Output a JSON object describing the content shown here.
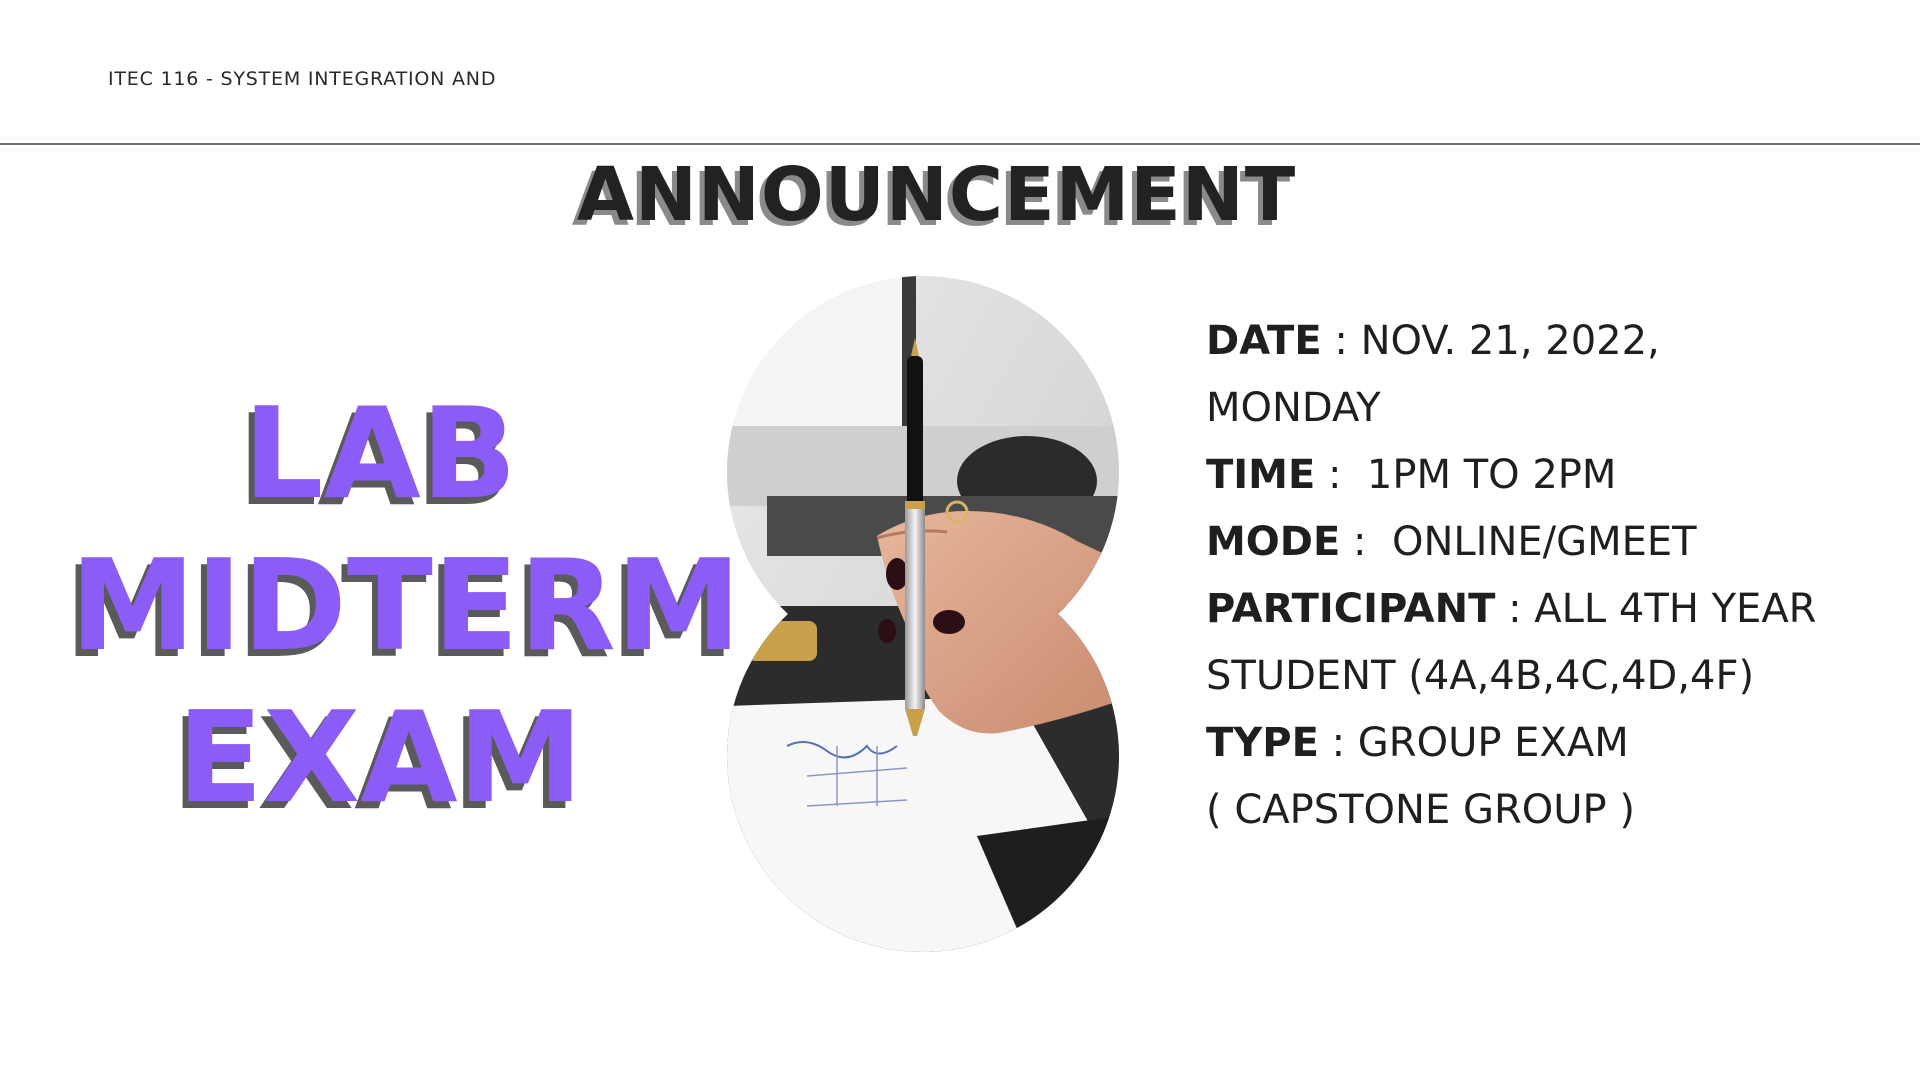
{
  "header": {
    "course": "ITEC 116 - SYSTEM INTEGRATION AND"
  },
  "headline": "ANNOUNCEMENT",
  "title": {
    "line1": "LAB",
    "line2": "MIDTERM",
    "line3": "EXAM"
  },
  "details": {
    "date_label": "DATE",
    "date_sep": " : ",
    "date_value": "NOV. 21, 2022,",
    "date_value2": "MONDAY",
    "time_label": "TIME",
    "time_sep": " :  ",
    "time_value": "1PM TO 2PM",
    "mode_label": "MODE",
    "mode_sep": " :  ",
    "mode_value": "ONLINE/GMEET",
    "participant_label": "PARTICIPANT",
    "participant_sep": " : ",
    "participant_value": "ALL 4TH YEAR",
    "participant_value2": "STUDENT (4A,4B,4C,4D,4F)",
    "type_label": "TYPE",
    "type_sep": " : ",
    "type_value": "GROUP EXAM",
    "type_value2": "( CAPSTONE GROUP )"
  },
  "colors": {
    "accent": "#8b5cf6",
    "text": "#1f1f1f",
    "shadow": "#5a5a5a"
  }
}
